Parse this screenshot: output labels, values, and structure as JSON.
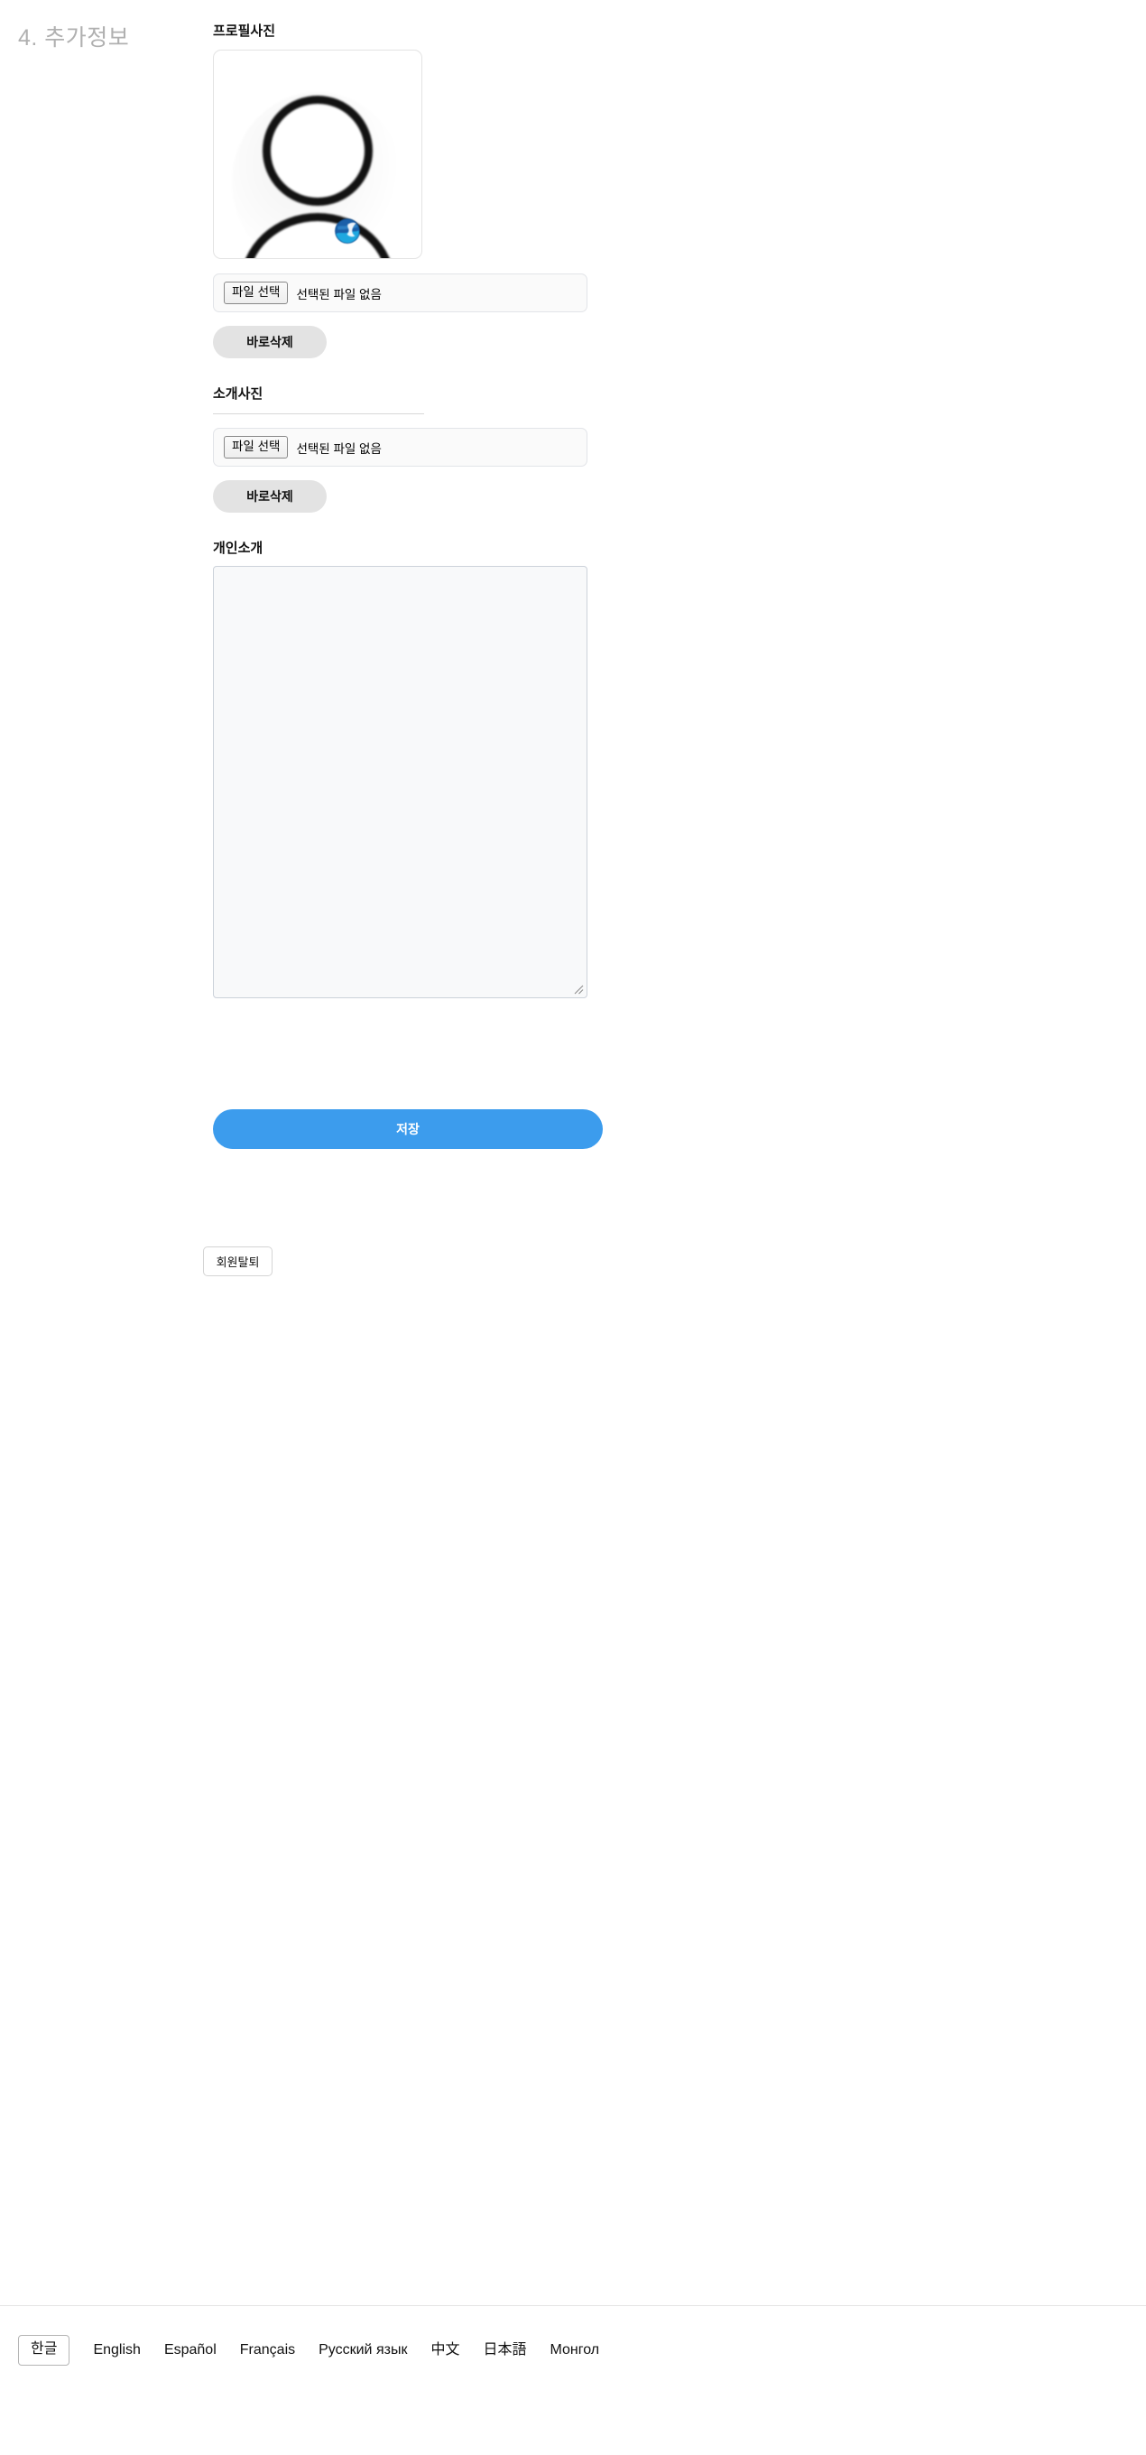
{
  "section": {
    "heading": "4. 추가정보"
  },
  "fields": {
    "profile_photo": {
      "label": "프로필사진",
      "avatar_alt": "person-avatar-placeholder",
      "badge_alt": "globe-badge",
      "file_button": "파일 선택",
      "file_status": "선택된 파일 없음",
      "delete_button": "바로삭제"
    },
    "intro_photo": {
      "label": "소개사진",
      "file_button": "파일 선택",
      "file_status": "선택된 파일 없음",
      "delete_button": "바로삭제"
    },
    "bio": {
      "label": "개인소개",
      "value": "",
      "placeholder": ""
    }
  },
  "actions": {
    "save_label": "저장",
    "withdraw_label": "회원탈퇴"
  },
  "footer": {
    "languages": [
      {
        "label": "한글",
        "selected": true
      },
      {
        "label": "English",
        "selected": false
      },
      {
        "label": "Español",
        "selected": false
      },
      {
        "label": "Français",
        "selected": false
      },
      {
        "label": "Русский язык",
        "selected": false
      },
      {
        "label": "中文",
        "selected": false
      },
      {
        "label": "日本語",
        "selected": false
      },
      {
        "label": "Монгол",
        "selected": false
      }
    ]
  },
  "colors": {
    "accent_blue": "#3c9ced",
    "pill_gray": "#e3e3e3",
    "heading_gray": "#b0b0b0",
    "field_bg": "#fafafa",
    "textarea_bg": "#f8f9fa"
  }
}
